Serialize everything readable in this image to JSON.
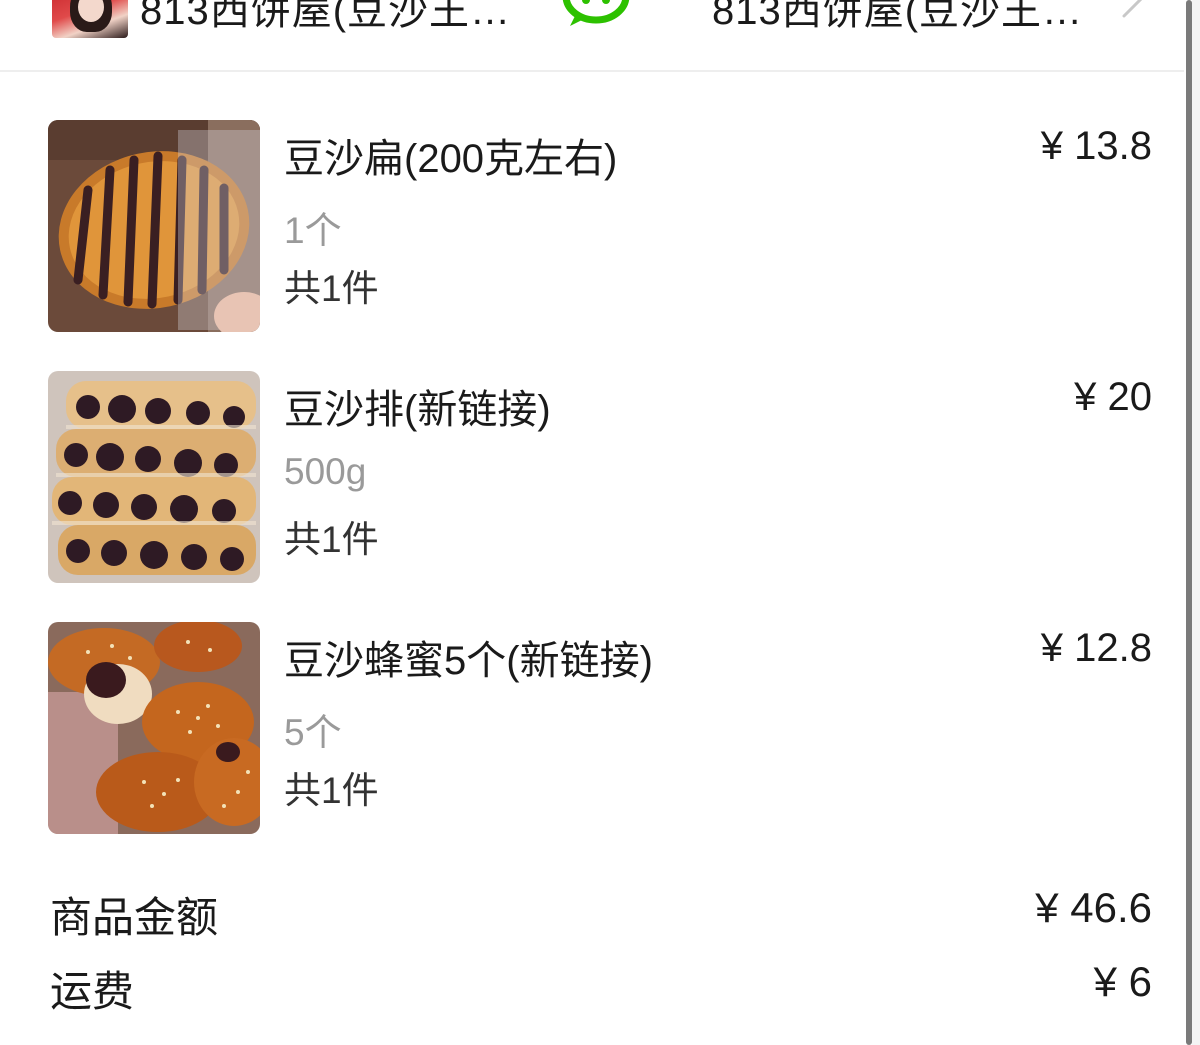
{
  "header": {
    "shop_name_left": "813西饼屋(豆沙王…",
    "shop_name_right": "813西饼屋(豆沙王…",
    "avatar_icon": "shop-avatar",
    "chat_icon": "wechat-icon",
    "nav_icon": "chevron-right-icon"
  },
  "items": [
    {
      "title": "豆沙扁(200克左右)",
      "spec": "1个",
      "qty": "共1件",
      "price": "¥ 13.8",
      "image": "red-bean-flat-pastry"
    },
    {
      "title": "豆沙排(新链接)",
      "spec": "500g",
      "qty": "共1件",
      "price": "¥ 20",
      "image": "red-bean-bread-rolls"
    },
    {
      "title": "豆沙蜂蜜5个(新链接)",
      "spec": "5个",
      "qty": "共1件",
      "price": "¥ 12.8",
      "image": "honey-red-bean-buns"
    }
  ],
  "summary": {
    "goods_label": "商品金额",
    "goods_value": "¥ 46.6",
    "shipping_label": "运费",
    "shipping_value": "¥ 6"
  },
  "colors": {
    "text": "#1a1a1a",
    "muted": "#9a9a9a",
    "wechat_green": "#2dc100",
    "divider": "#eeeeee"
  }
}
